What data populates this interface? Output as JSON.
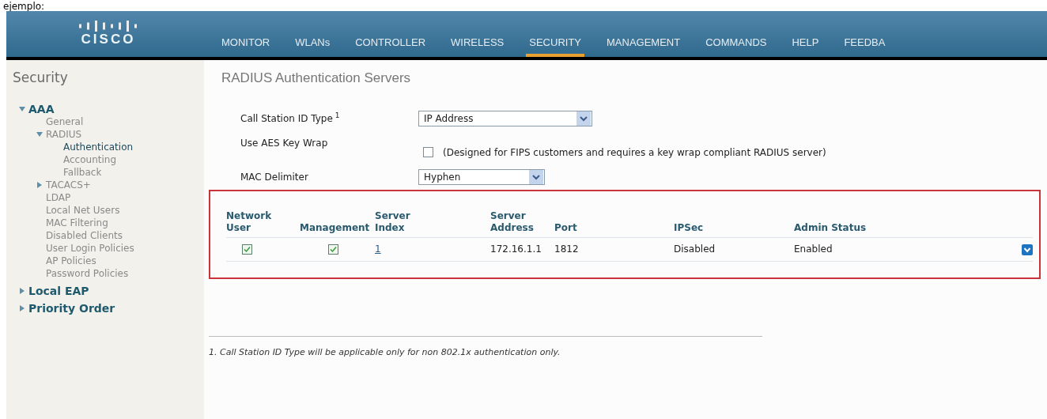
{
  "caption": "ejemplo:",
  "logo": {
    "text": "CISCO"
  },
  "nav": [
    {
      "label": "MONITOR",
      "selected": false
    },
    {
      "label": "WLANs",
      "selected": false
    },
    {
      "label": "CONTROLLER",
      "selected": false
    },
    {
      "label": "WIRELESS",
      "selected": false
    },
    {
      "label": "SECURITY",
      "selected": true
    },
    {
      "label": "MANAGEMENT",
      "selected": false
    },
    {
      "label": "COMMANDS",
      "selected": false
    },
    {
      "label": "HELP",
      "selected": false
    },
    {
      "label": "FEEDBA",
      "selected": false
    }
  ],
  "sidebar": {
    "title": "Security",
    "items": [
      {
        "label": "AAA",
        "expanded": true,
        "selected": false,
        "children": [
          {
            "label": "General",
            "selected": false
          },
          {
            "label": "RADIUS",
            "expanded": true,
            "selected": false,
            "children": [
              {
                "label": "Authentication",
                "selected": true
              },
              {
                "label": "Accounting",
                "selected": false
              },
              {
                "label": "Fallback",
                "selected": false
              }
            ]
          },
          {
            "label": "TACACS+",
            "expanded": false,
            "selected": false
          },
          {
            "label": "LDAP",
            "selected": false
          },
          {
            "label": "Local Net Users",
            "selected": false
          },
          {
            "label": "MAC Filtering",
            "selected": false
          },
          {
            "label": "Disabled Clients",
            "selected": false
          },
          {
            "label": "User Login Policies",
            "selected": false
          },
          {
            "label": "AP Policies",
            "selected": false
          },
          {
            "label": "Password Policies",
            "selected": false
          }
        ]
      },
      {
        "label": "Local EAP",
        "expanded": false,
        "selected": false
      },
      {
        "label": "Priority Order",
        "expanded": false,
        "selected": false
      }
    ]
  },
  "page_title": "RADIUS Authentication Servers",
  "form": [
    {
      "kind": "select",
      "label": "Call Station ID Type",
      "footnote_mark": "1",
      "value": "IP Address"
    },
    {
      "kind": "checkbox",
      "label": "Use AES Key Wrap",
      "checked": false,
      "note": "(Designed for FIPS customers and requires a key wrap compliant RADIUS server)"
    },
    {
      "kind": "select",
      "label": "MAC Delimiter",
      "value": "Hyphen"
    }
  ],
  "table": {
    "columns": [
      [
        "Network",
        "User"
      ],
      [
        "Management"
      ],
      [
        "Server",
        "Index"
      ],
      [
        "Server Address"
      ],
      [
        "Port"
      ],
      [
        "IPSec"
      ],
      [
        "Admin Status"
      ]
    ],
    "rows": [
      {
        "network_user": true,
        "management": true,
        "index": "1",
        "address": "172.16.1.1",
        "port": "1812",
        "ipsec": "Disabled",
        "admin_status": "Enabled"
      }
    ]
  },
  "footnote": "1. Call Station ID Type will be applicable only for non 802.1x authentication only."
}
